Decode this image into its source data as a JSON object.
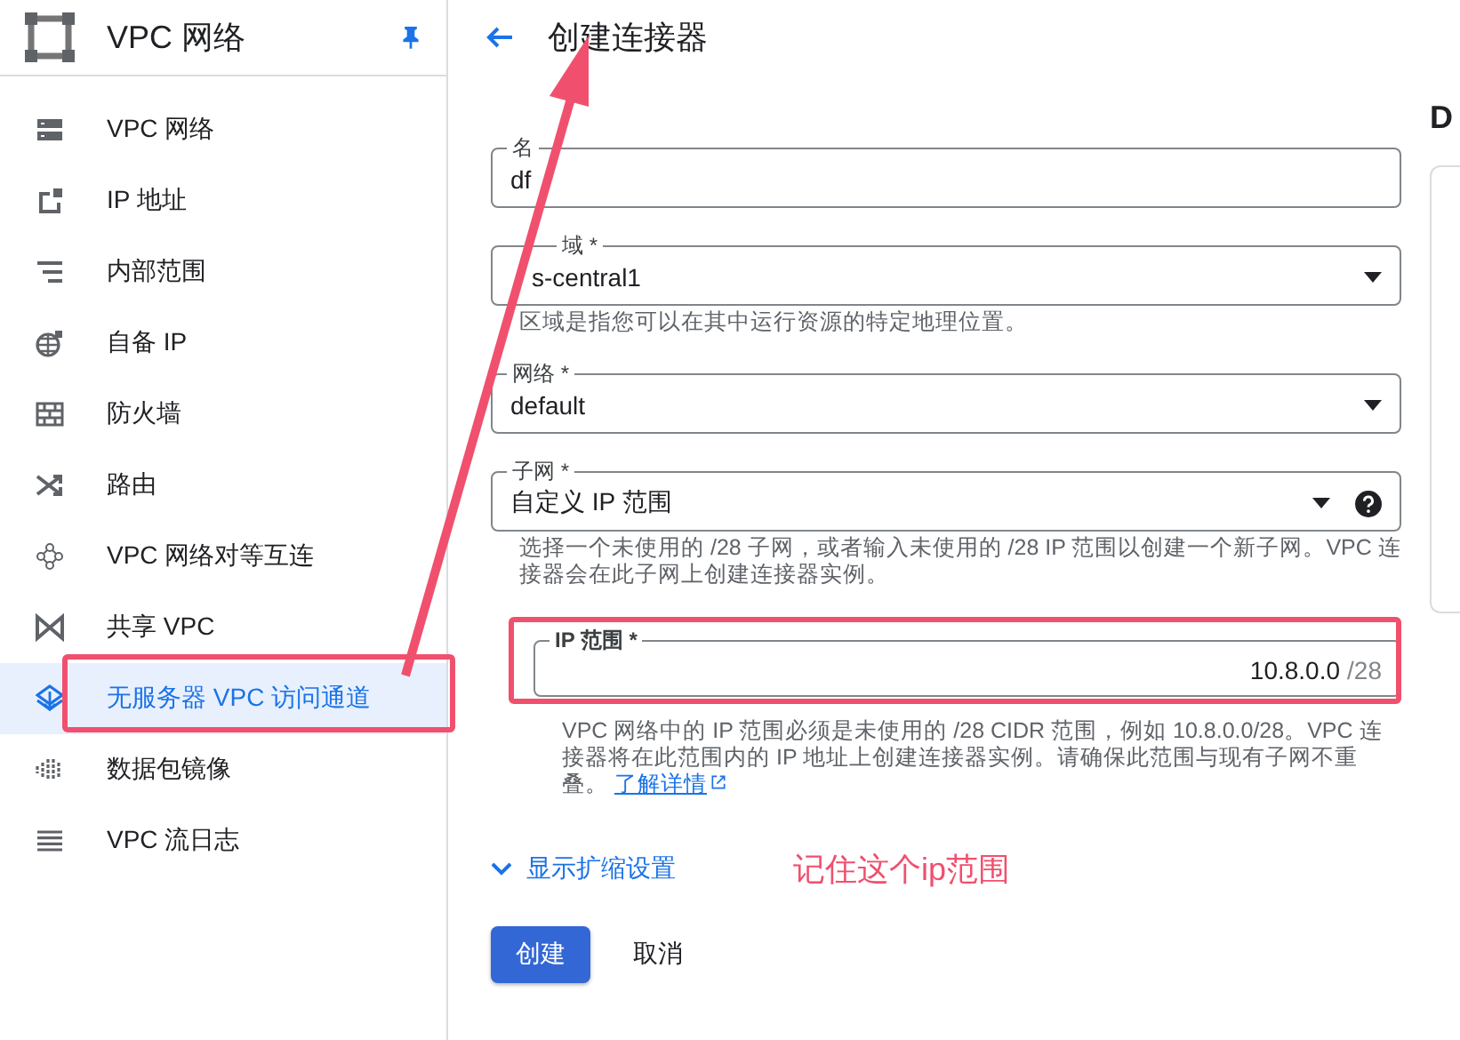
{
  "sidebar": {
    "title": "VPC 网络",
    "pinned": true,
    "items": [
      {
        "label": "VPC 网络",
        "selected": false
      },
      {
        "label": "IP 地址",
        "selected": false
      },
      {
        "label": "内部范围",
        "selected": false
      },
      {
        "label": "自备 IP",
        "selected": false
      },
      {
        "label": "防火墙",
        "selected": false
      },
      {
        "label": "路由",
        "selected": false
      },
      {
        "label": "VPC 网络对等互连",
        "selected": false
      },
      {
        "label": "共享 VPC",
        "selected": false
      },
      {
        "label": "无服务器 VPC 访问通道",
        "selected": true
      },
      {
        "label": "数据包镜像",
        "selected": false
      },
      {
        "label": "VPC 流日志",
        "selected": false
      }
    ]
  },
  "page": {
    "title": "创建连接器"
  },
  "form": {
    "fields": [
      {
        "kind": "text",
        "label": "名",
        "value": "df"
      },
      {
        "kind": "select",
        "label": "域 *",
        "value": "s-central1",
        "hint": "区域是指您可以在其中运行资源的特定地理位置。"
      },
      {
        "kind": "select",
        "label": "网络 *",
        "value": "default"
      },
      {
        "kind": "select-help",
        "label": "子网 *",
        "value": "自定义 IP 范围",
        "hint": "选择一个未使用的 /28 子网，或者输入未使用的 /28 IP 范围以创建一个新子网。VPC 连接器会在此子网上创建连接器实例。"
      },
      {
        "kind": "ip",
        "label": "IP 范围 *",
        "value": "10.8.0.0",
        "suffix": "/28",
        "hint": "VPC 网络中的 IP 范围必须是未使用的 /28 CIDR 范围，例如 10.8.0.0/28。VPC 连接器将在此范围内的 IP 地址上创建连接器实例。请确保此范围与现有子网不重叠。",
        "link": "了解详情"
      }
    ],
    "expand": "显示扩缩设置",
    "buttons": [
      {
        "label": "创建",
        "kind": "primary"
      },
      {
        "label": "取消",
        "kind": "text"
      }
    ]
  },
  "side_panel": {
    "heading": "D"
  },
  "annotation": {
    "note": "记住这个ip范围"
  }
}
